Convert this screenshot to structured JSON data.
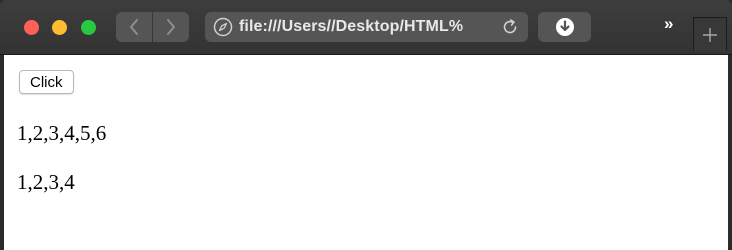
{
  "browser": {
    "address_url": "file:///Users//Desktop/HTML%",
    "overflow_label": "»",
    "new_tab_label": "+",
    "icons": [
      "back-chevron-icon",
      "forward-chevron-icon",
      "compass-icon",
      "reload-icon",
      "download-icon"
    ],
    "colors": {
      "close": "#fe5f57",
      "minimize": "#febc2e",
      "zoom": "#28c840",
      "toolbar": "#3a3a3a",
      "control": "#555555"
    }
  },
  "page": {
    "button_label": "Click",
    "lines": [
      "1,2,3,4,5,6",
      "1,2,3,4"
    ]
  }
}
